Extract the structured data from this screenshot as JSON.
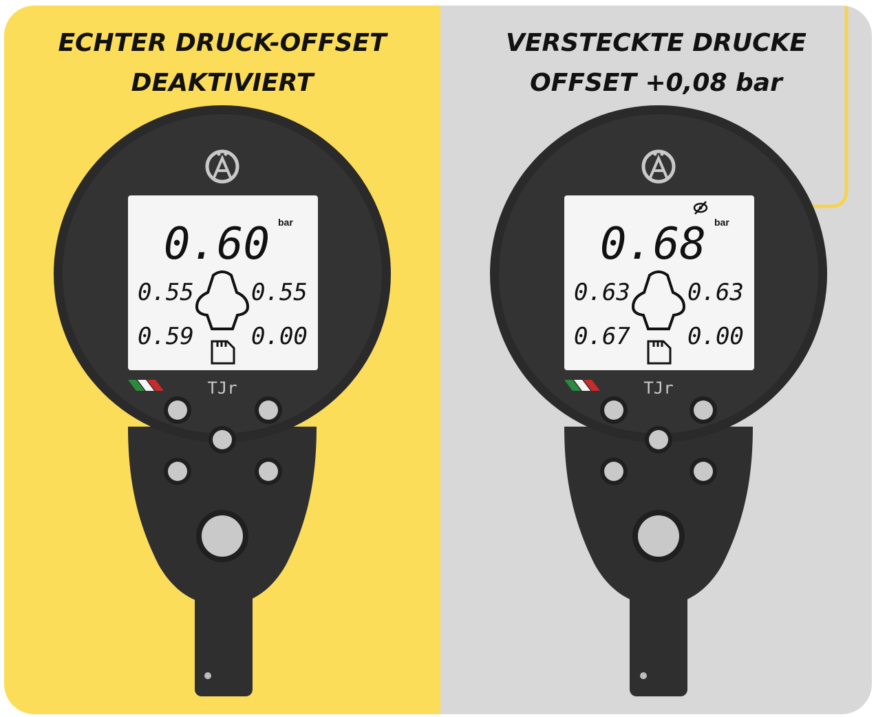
{
  "colors": {
    "left_background": "#fcdd5a",
    "right_background": "#d8d8d8",
    "device_body": "#2f2f2f",
    "device_ring": "#262626",
    "lcd": "#f5f5f5",
    "button": "#c9c9c9",
    "callout_arrow": "#f7d34c"
  },
  "left_panel": {
    "title_line1": "ECHTER DRUCK-OFFSET",
    "title_line2": "DEAKTIVIERT",
    "display": {
      "main_value": "0.60",
      "unit": "bar",
      "front_left": "0.55",
      "front_right": "0.55",
      "rear_left": "0.59",
      "rear_right": "0.00",
      "hidden_icon_visible": false
    },
    "brand": "TJr"
  },
  "right_panel": {
    "title_line1": "VERSTECKTE DRUCKE",
    "title_line2": "OFFSET +0,08 bar",
    "display": {
      "main_value": "0.68",
      "unit": "bar",
      "front_left": "0.63",
      "front_right": "0.63",
      "rear_left": "0.67",
      "rear_right": "0.00",
      "hidden_icon_visible": true,
      "hidden_icon": "eye-slash-icon"
    },
    "brand": "TJr"
  },
  "icons": {
    "logo": "brand-a-logo",
    "kart": "kart-outline-icon",
    "memory": "sd-card-icon",
    "flag": "italian-flag-icon"
  }
}
